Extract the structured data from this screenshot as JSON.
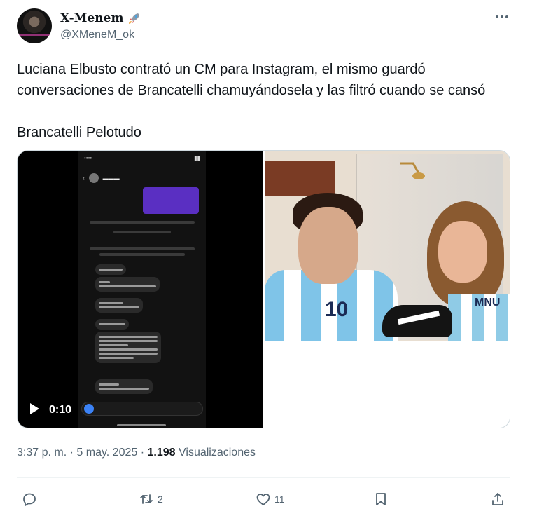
{
  "author": {
    "display_name": "X-Menem",
    "handle": "@XMeneM_ok"
  },
  "tweet": {
    "paragraphs": [
      "Luciana Elbusto contrató un CM para Instagram, el mismo guardó conversaciones de Brancatelli chamuyándosela y las filtró cuando se cansó",
      "Brancatelli Pelotudo"
    ]
  },
  "media": {
    "video": {
      "time": "0:10"
    },
    "photo": {
      "shirt_number": "10",
      "top_text": "MNU"
    }
  },
  "meta": {
    "time": "3:37 p. m.",
    "separator": "·",
    "date": "5 may. 2025",
    "views_count": "1.198",
    "views_label": "Visualizaciones"
  },
  "actions": {
    "reply_count": "",
    "retweet_count": "2",
    "like_count": "11"
  },
  "colors": {
    "text_primary": "#0f1419",
    "text_secondary": "#536471",
    "border": "#cfd9de"
  },
  "icons": [
    "rocket-icon",
    "more-icon",
    "play-icon",
    "reply-icon",
    "retweet-icon",
    "like-icon",
    "bookmark-icon",
    "share-icon"
  ]
}
